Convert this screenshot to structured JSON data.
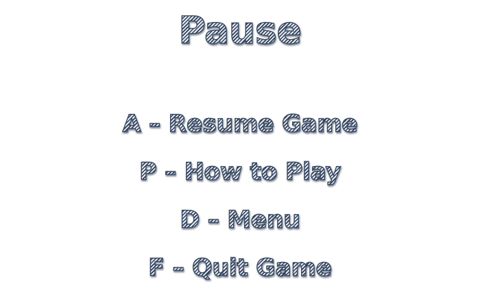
{
  "pause_screen": {
    "title": "Pause",
    "options": [
      {
        "key": "A",
        "label": "A – Resume Game"
      },
      {
        "key": "P",
        "label": "P – How to Play"
      },
      {
        "key": "D",
        "label": "D – Menu"
      },
      {
        "key": "F",
        "label": "F – Quit Game"
      }
    ],
    "colors": {
      "stripe_dark": "#2e3e56",
      "stripe_light": "#e4e9f0",
      "outline": "#3a4b66",
      "background": "#ffffff"
    }
  }
}
